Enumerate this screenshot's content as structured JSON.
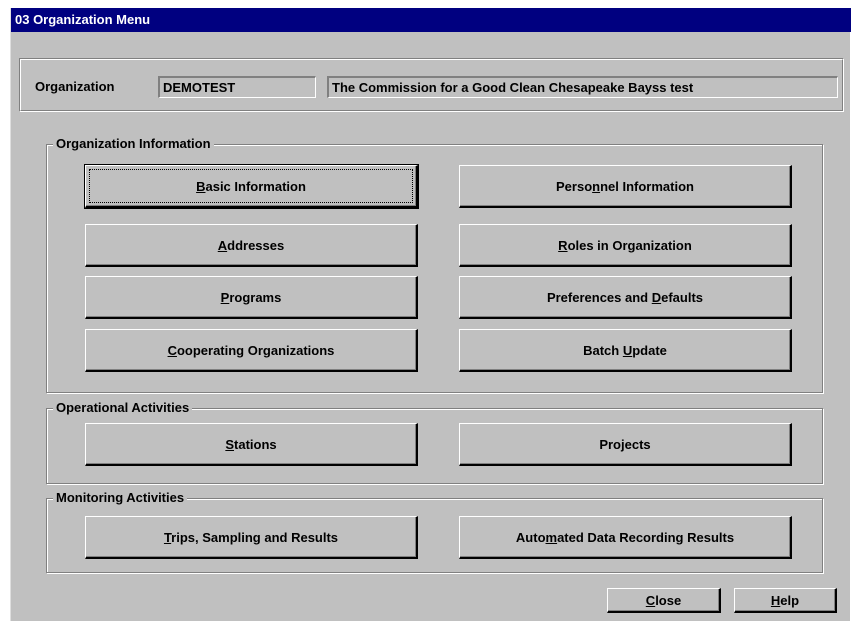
{
  "window": {
    "title": "03 Organization Menu"
  },
  "organization": {
    "label": "Organization",
    "code": "DEMOTEST",
    "name": "The Commission for a Good Clean Chesapeake Bayss test"
  },
  "groups": {
    "org_info": {
      "title": "Organization Information",
      "buttons": {
        "basic_information": {
          "pre": "",
          "key": "B",
          "post": "asic Information"
        },
        "personnel_information": {
          "pre": "Perso",
          "key": "n",
          "post": "nel Information"
        },
        "addresses": {
          "pre": "",
          "key": "A",
          "post": "ddresses"
        },
        "roles_in_organization": {
          "pre": "",
          "key": "R",
          "post": "oles in Organization"
        },
        "programs": {
          "pre": "",
          "key": "P",
          "post": "rograms"
        },
        "preferences_and_defaults": {
          "pre": "Preferences and ",
          "key": "D",
          "post": "efaults"
        },
        "cooperating_organizations": {
          "pre": "",
          "key": "C",
          "post": "ooperating Organizations"
        },
        "batch_update": {
          "pre": "Batch ",
          "key": "U",
          "post": "pdate"
        }
      }
    },
    "operational": {
      "title": "Operational Activities",
      "buttons": {
        "stations": {
          "pre": "",
          "key": "S",
          "post": "tations"
        },
        "projects": {
          "pre": "Pro",
          "key": "j",
          "post": "ects"
        }
      }
    },
    "monitoring": {
      "title": "Monitoring Activities",
      "buttons": {
        "trips": {
          "pre": "",
          "key": "T",
          "post": "rips, Sampling and Results"
        },
        "automated": {
          "pre": "Auto",
          "key": "m",
          "post": "ated Data Recording Results"
        }
      }
    }
  },
  "footer": {
    "close": {
      "pre": "",
      "key": "C",
      "post": "lose"
    },
    "help": {
      "pre": "",
      "key": "H",
      "post": "elp"
    }
  },
  "colors": {
    "titlebar": "#000080",
    "face": "#c0c0c0"
  }
}
